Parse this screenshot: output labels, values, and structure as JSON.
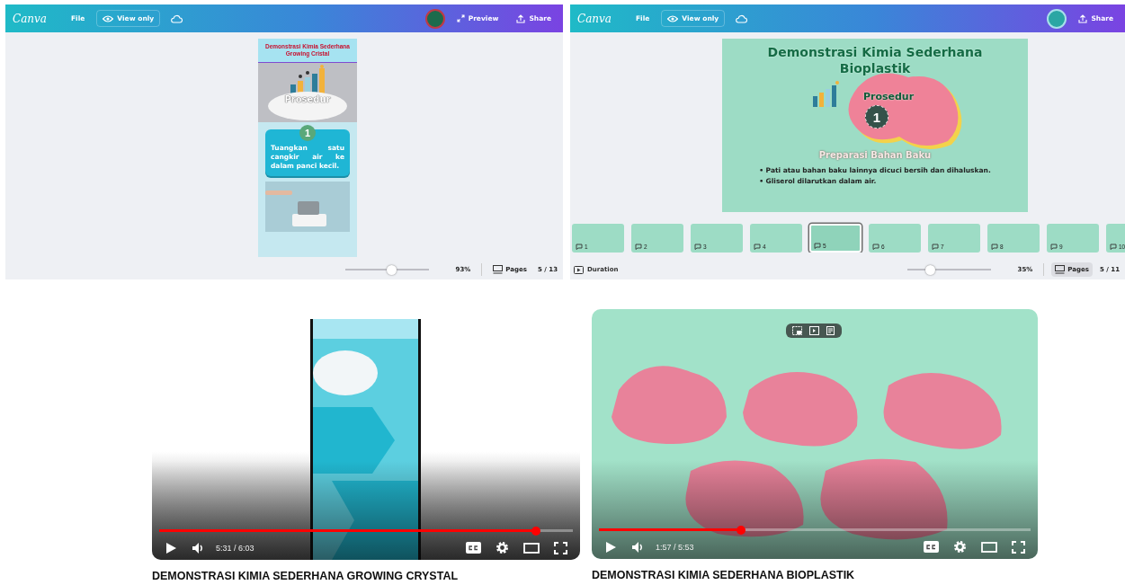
{
  "editors": [
    {
      "toolbar": {
        "logo": "Canva",
        "file": "File",
        "view_mode": "View only",
        "preview": "Preview",
        "share": "Share"
      },
      "slide": {
        "kind": "portrait",
        "title": "Demonstrasi Kimia Sederhana Growing Cristal",
        "heading": "Prosedur",
        "step": "1",
        "step_text": "Tuangkan satu cangkir air ke dalam panci kecil."
      },
      "footer": {
        "level": 0.55,
        "zoom": "93%",
        "pages": "Pages",
        "page_count": "5 / 13"
      }
    },
    {
      "toolbar": {
        "logo": "Canva",
        "file": "File",
        "view_mode": "View only",
        "share": "Share"
      },
      "slide": {
        "kind": "landscape",
        "title": "Demonstrasi Kimia Sederhana Bioplastik",
        "heading": "Prosedur",
        "step": "1",
        "subheading": "Preparasi Bahan Baku",
        "bullets": [
          "• Pati atau bahan baku lainnya dicuci bersih dan dihaluskan.",
          "• Gliserol dilarutkan dalam air."
        ]
      },
      "thumbnails": [
        {
          "number": "1",
          "selected": false
        },
        {
          "number": "2",
          "selected": false
        },
        {
          "number": "3",
          "selected": false
        },
        {
          "number": "4",
          "selected": false
        },
        {
          "number": "5",
          "selected": true
        },
        {
          "number": "6",
          "selected": false
        },
        {
          "number": "7",
          "selected": false
        },
        {
          "number": "8",
          "selected": false
        },
        {
          "number": "9",
          "selected": false
        },
        {
          "number": "10",
          "selected": false
        }
      ],
      "footer": {
        "duration": "Duration",
        "level": 0.3,
        "zoom": "35%",
        "pages": "Pages",
        "page_count": "5 / 11"
      }
    }
  ],
  "videos": [
    {
      "time": "5:31 / 6:03",
      "level": 0.91,
      "title": "DEMONSTRASI KIMIA SEDERHANA GROWING CRYSTAL"
    },
    {
      "time": "1:57 / 5:53",
      "level": 0.33,
      "title": "DEMONSTRASI KIMIA SEDERHANA BIOPLASTIK"
    }
  ]
}
